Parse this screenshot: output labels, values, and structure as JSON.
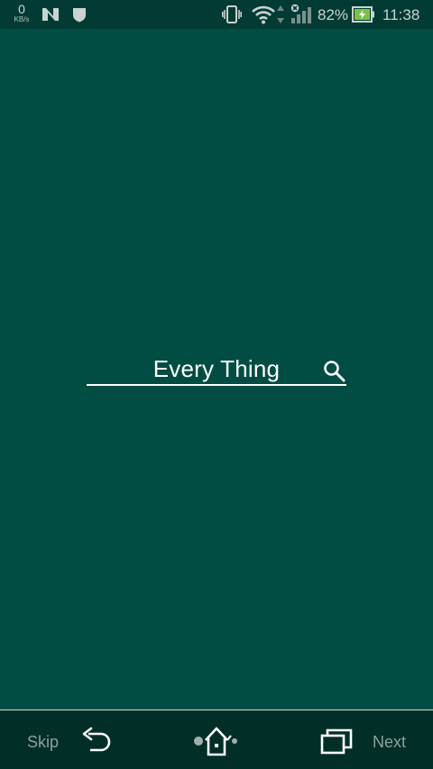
{
  "status_bar": {
    "net_speed_value": "0",
    "net_speed_unit": "KB/s",
    "battery_percent": "82%",
    "time": "11:38",
    "icons": [
      "n-notification-icon",
      "shield-icon",
      "vibrate-icon",
      "wifi-icon",
      "no-signal-icon",
      "battery-charging-icon"
    ]
  },
  "search": {
    "text": "Every Thing",
    "icon": "search-icon"
  },
  "nav": {
    "skip_label": "Skip",
    "next_label": "Next",
    "icons": [
      "back-icon",
      "home-icon",
      "recent-apps-icon"
    ]
  },
  "colors": {
    "background": "#024d43",
    "status_bar": "#013b33",
    "nav_bar": "#012f28",
    "text": "#ffffff"
  }
}
